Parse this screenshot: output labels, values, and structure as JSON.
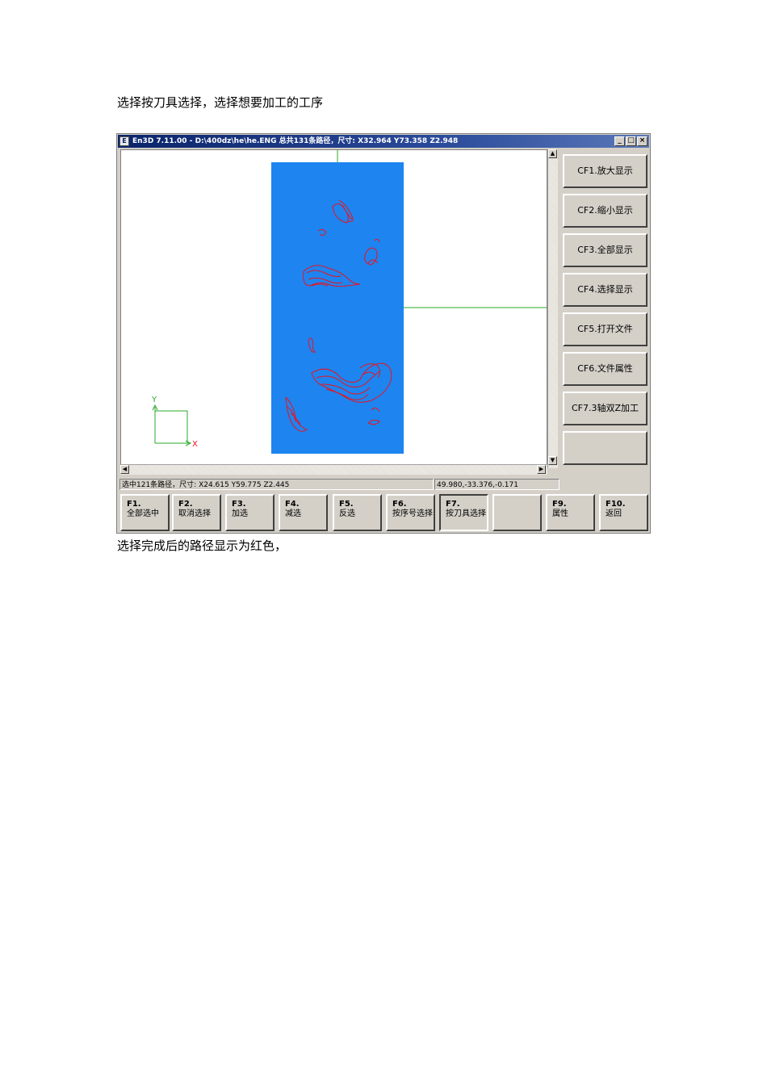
{
  "captions": {
    "top": "选择按刀具选择，选择想要加工的工序",
    "bottom": "选择完成后的路径显示为红色，"
  },
  "window": {
    "title": "En3D 7.11.00 - D:\\400dz\\he\\he.ENG  总共131条路径，尺寸: X32.964 Y73.358 Z2.948",
    "icon": "app-icon",
    "minimize": "_",
    "maximize": "□",
    "close": "×"
  },
  "side_panel": [
    {
      "label": "CF1.放大显示"
    },
    {
      "label": "CF2.缩小显示"
    },
    {
      "label": "CF3.全部显示"
    },
    {
      "label": "CF4.选择显示"
    },
    {
      "label": "CF5.打开文件"
    },
    {
      "label": "CF6.文件属性"
    },
    {
      "label": "CF7.3轴双Z加工"
    },
    {
      "label": ""
    }
  ],
  "status": {
    "left": "选中121条路径，尺寸: X24.615 Y59.775 Z2.445",
    "right": "49.980,-33.376,-0.171"
  },
  "function_keys": [
    {
      "key": "F1.",
      "label": "全部选中"
    },
    {
      "key": "F2.",
      "label": "取消选择"
    },
    {
      "key": "F3.",
      "label": "加选"
    },
    {
      "key": "F4.",
      "label": "减选"
    },
    {
      "key": "F5.",
      "label": "反选"
    },
    {
      "key": "F6.",
      "label": "按序号选择"
    },
    {
      "key": "F7.",
      "label": "按刀具选择"
    },
    {
      "key": "",
      "label": ""
    },
    {
      "key": "F9.",
      "label": "属性"
    },
    {
      "key": "F10.",
      "label": "返回"
    }
  ],
  "axes": {
    "x": "X",
    "y": "Y"
  },
  "colors": {
    "workpiece": "#1e84f0",
    "selected_path": "#e8141e",
    "axis": "#2aa82a",
    "titlebar": "#0a246a"
  }
}
